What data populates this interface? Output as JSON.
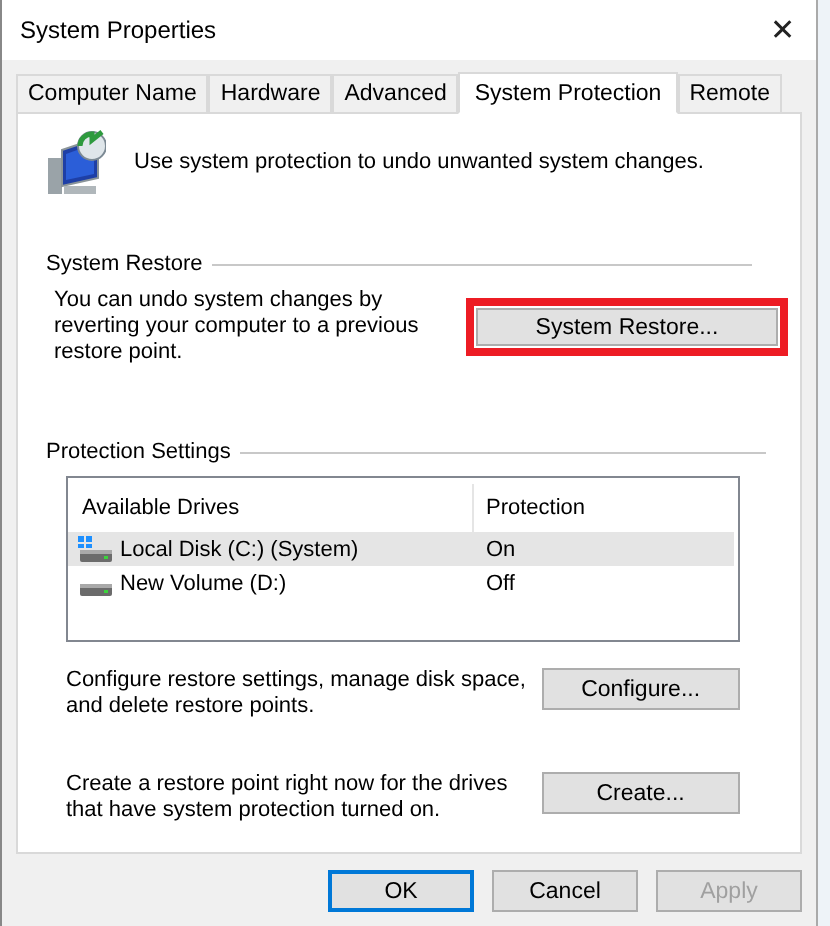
{
  "window": {
    "title": "System Properties",
    "close": "✕"
  },
  "tabs": [
    {
      "label": "Computer Name",
      "selected": false
    },
    {
      "label": "Hardware",
      "selected": false
    },
    {
      "label": "Advanced",
      "selected": false
    },
    {
      "label": "System Protection",
      "selected": true
    },
    {
      "label": "Remote",
      "selected": false
    }
  ],
  "intro": "Use system protection to undo unwanted system changes.",
  "system_restore": {
    "heading": "System Restore",
    "description": "You can undo system changes by reverting your computer to a previous restore point.",
    "button": {
      "label": "System Restore...",
      "highlighted": true
    }
  },
  "protection_settings": {
    "heading": "Protection Settings",
    "columns": [
      "Available Drives",
      "Protection"
    ],
    "rows": [
      {
        "kind": "system",
        "drive": "Local Disk (C:) (System)",
        "protection": "On",
        "selected": true
      },
      {
        "kind": "plain",
        "drive": "New Volume (D:)",
        "protection": "Off",
        "selected": false
      }
    ],
    "actions": [
      {
        "description": "Configure restore settings, manage disk space, and delete restore points.",
        "button": "Configure..."
      },
      {
        "description": "Create a restore point right now for the drives that have system protection turned on.",
        "button": "Create..."
      }
    ]
  },
  "buttons": [
    {
      "label": "OK",
      "default": true,
      "disabled": false
    },
    {
      "label": "Cancel",
      "default": false,
      "disabled": false
    },
    {
      "label": "Apply",
      "default": false,
      "disabled": true
    }
  ]
}
